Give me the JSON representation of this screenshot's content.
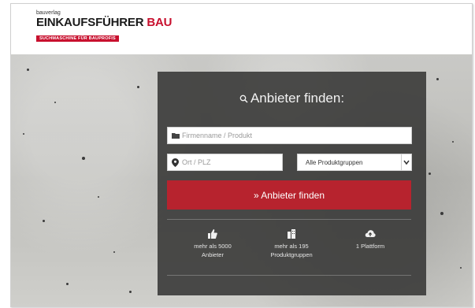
{
  "header": {
    "publisher": "bauverlag",
    "brand_main": "EINKAUFSFÜHRER",
    "brand_accent": "BAU",
    "tagline": "SUCHMASCHINE FÜR BAUPROFIS"
  },
  "search": {
    "title": "Anbieter finden:",
    "company_placeholder": "Firmenname / Produkt",
    "location_placeholder": "Ort / PLZ",
    "group_select_value": "Alle Produktgruppen",
    "submit_label": "» Anbieter finden"
  },
  "stats": [
    {
      "icon": "thumbs-up-icon",
      "line1": "mehr als 5000",
      "line2": "Anbieter"
    },
    {
      "icon": "buildings-icon",
      "line1": "mehr als 195",
      "line2": "Produktgruppen"
    },
    {
      "icon": "cloud-upload-icon",
      "line1": "1 Plattform",
      "line2": ""
    }
  ],
  "colors": {
    "brand_red": "#c8102e",
    "button_red": "#b7232e",
    "panel_dark": "#3a3a38"
  }
}
